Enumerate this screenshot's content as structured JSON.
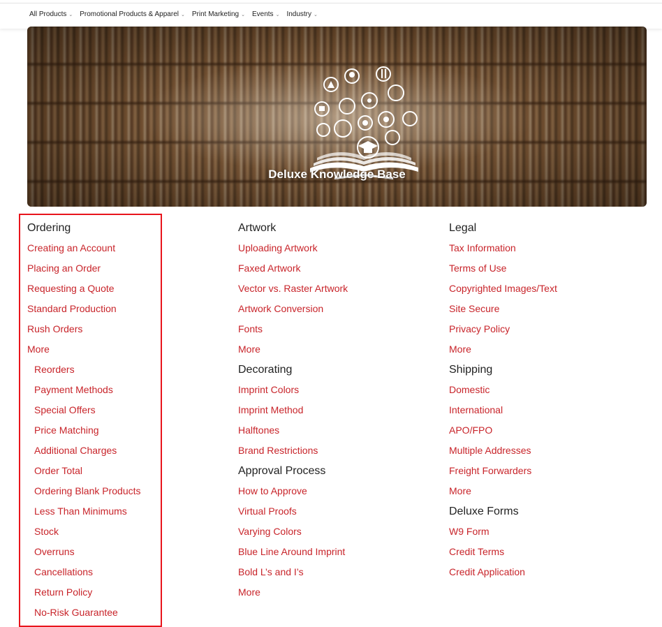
{
  "nav": {
    "items": [
      {
        "label": "All Products"
      },
      {
        "label": "Promotional Products & Apparel"
      },
      {
        "label": "Print Marketing"
      },
      {
        "label": "Events"
      },
      {
        "label": "Industry"
      }
    ]
  },
  "hero": {
    "title": "Deluxe Knowledge Base"
  },
  "colors": {
    "link": "#c8242a",
    "highlight": "#e8141c"
  },
  "columns": {
    "ordering": {
      "title": "Ordering",
      "links": [
        "Creating an Account",
        "Placing an Order",
        "Requesting a Quote",
        "Standard Production",
        "Rush Orders",
        "More"
      ],
      "sublinks": [
        "Reorders",
        "Payment Methods",
        "Special Offers",
        "Price Matching",
        "Additional Charges",
        "Order Total",
        "Ordering Blank Products",
        "Less Than Minimums",
        "Stock",
        "Overruns",
        "Cancellations",
        "Return Policy",
        "No-Risk Guarantee"
      ]
    },
    "artwork": {
      "title": "Artwork",
      "links": [
        "Uploading Artwork",
        "Faxed Artwork",
        "Vector vs. Raster Artwork",
        "Artwork Conversion",
        "Fonts",
        "More"
      ]
    },
    "decorating": {
      "title": "Decorating",
      "links": [
        "Imprint Colors",
        "Imprint Method",
        "Halftones",
        "Brand Restrictions"
      ]
    },
    "approval": {
      "title": "Approval Process",
      "links": [
        "How to Approve",
        "Virtual Proofs",
        "Varying Colors",
        "Blue Line Around Imprint",
        "Bold L’s and I’s",
        "More"
      ]
    },
    "legal": {
      "title": "Legal",
      "links": [
        "Tax Information",
        "Terms of Use",
        "Copyrighted Images/Text",
        "Site Secure",
        "Privacy Policy",
        "More"
      ]
    },
    "shipping": {
      "title": "Shipping",
      "links": [
        "Domestic",
        "International",
        "APO/FPO",
        "Multiple Addresses",
        "Freight Forwarders",
        "More"
      ]
    },
    "forms": {
      "title": "Deluxe Forms",
      "links": [
        "W9 Form",
        "Credit Terms",
        "Credit Application"
      ]
    }
  }
}
